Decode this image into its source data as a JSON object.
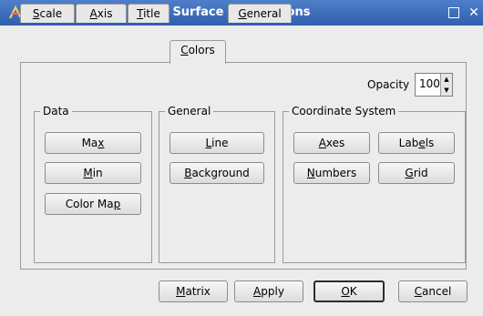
{
  "window": {
    "title": "Surface Plot Options"
  },
  "tabs": [
    {
      "pre": "",
      "key": "S",
      "post": "cale"
    },
    {
      "pre": "",
      "key": "A",
      "post": "xis"
    },
    {
      "pre": "",
      "key": "T",
      "post": "itle"
    },
    {
      "pre": "",
      "key": "C",
      "post": "olors"
    },
    {
      "pre": "",
      "key": "G",
      "post": "eneral"
    }
  ],
  "opacity": {
    "label": "Opacity",
    "value": "100"
  },
  "groups": {
    "data": {
      "title": "Data"
    },
    "general": {
      "title": "General"
    },
    "coord": {
      "title": "Coordinate System"
    }
  },
  "buttons": {
    "max": {
      "pre": "Ma",
      "key": "x",
      "post": ""
    },
    "min": {
      "pre": "",
      "key": "M",
      "post": "in"
    },
    "colormap": {
      "pre": "Color Ma",
      "key": "p",
      "post": ""
    },
    "line": {
      "pre": "",
      "key": "L",
      "post": "ine"
    },
    "background": {
      "pre": "",
      "key": "B",
      "post": "ackground"
    },
    "axes": {
      "pre": "",
      "key": "A",
      "post": "xes"
    },
    "labels": {
      "pre": "Lab",
      "key": "e",
      "post": "ls"
    },
    "numbers": {
      "pre": "",
      "key": "N",
      "post": "umbers"
    },
    "grid": {
      "pre": "",
      "key": "G",
      "post": "rid"
    }
  },
  "footer": {
    "matrix": {
      "pre": "",
      "key": "M",
      "post": "atrix"
    },
    "apply": {
      "pre": "",
      "key": "A",
      "post": "pply"
    },
    "ok": {
      "pre": "",
      "key": "O",
      "post": "K"
    },
    "cancel": {
      "pre": "",
      "key": "C",
      "post": "ancel"
    }
  }
}
